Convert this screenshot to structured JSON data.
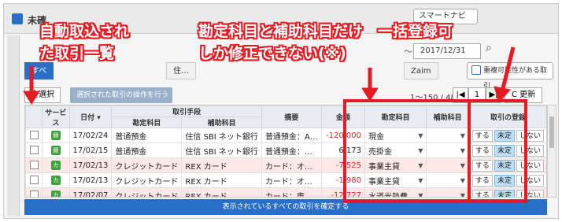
{
  "app": {
    "title": "未確",
    "nav_button": "スマートナビ"
  },
  "date_filter": {
    "tilde": "〜",
    "end_date": "2017/12/31"
  },
  "tabs": [
    {
      "label": "すべ",
      "active": true
    },
    {
      "label": "住…",
      "active": false
    },
    {
      "label": "Zaim",
      "active": false
    }
  ],
  "toolbar": {
    "duplicate_button": "重複可能性がある取引"
  },
  "actions": {
    "select_all": "全選択",
    "bulk_operation": "選択された取引の操作を行う ▾",
    "count_text": "1〜150 / 480",
    "pager_first": "|◀",
    "page_number": "1",
    "pager_next": "▶|",
    "refresh_label": "C 更新"
  },
  "table": {
    "headers": {
      "service": "サービス",
      "date": "日付 ▾",
      "method": "取引手段",
      "account_item": "勘定科目",
      "sub_item": "補助科目",
      "memo": "摘要",
      "amount": "金額",
      "main_account": "勘定科目",
      "sub_account": "補助科目",
      "register": "取引の登録"
    },
    "rows": [
      {
        "service": "銀",
        "date": "17/02/24",
        "account": "普通預金",
        "sub": "住信 SBI ネット銀行",
        "memo": "普通預金：A…",
        "amount": "-120,000",
        "negative": true,
        "cat": "現金",
        "pink": false
      },
      {
        "service": "銀",
        "date": "17/02/15",
        "account": "普通預金",
        "sub": "住信 SBI ネット銀行",
        "memo": "普通預金：…",
        "amount": "6,173",
        "negative": false,
        "cat": "売掛金",
        "pink": false
      },
      {
        "service": "カ",
        "date": "17/02/13",
        "account": "クレジットカード",
        "sub": "REX カード",
        "memo": "カード：オ…",
        "amount": "-7,525",
        "negative": true,
        "cat": "事業主貸",
        "pink": true
      },
      {
        "service": "カ",
        "date": "17/02/13",
        "account": "クレジットカード",
        "sub": "REX カード",
        "memo": "カード：オ…",
        "amount": "-1,980",
        "negative": true,
        "cat": "事業主貸",
        "pink": false
      },
      {
        "service": "カ",
        "date": "17/02/07",
        "account": "クレジットカード",
        "sub": "REX カード",
        "memo": "カード：東…",
        "amount": "-12,727",
        "negative": true,
        "cat": "水道光熱費",
        "pink": true
      }
    ],
    "register_options": {
      "yes": "する",
      "undecided": "未定",
      "no": "しない"
    }
  },
  "confirm_button": "表示されているすべての取引を確定する",
  "annotations": {
    "left_line1": "自動取込され",
    "left_line2": "た取引一覧",
    "right_line1": "勘定科目と補助科目だけ　一括登録可",
    "right_line2": "しか修正できない(※)"
  },
  "colors": {
    "annotation_red": "#e51b23",
    "primary_blue": "#2a6fc7",
    "negative": "#e32626"
  }
}
